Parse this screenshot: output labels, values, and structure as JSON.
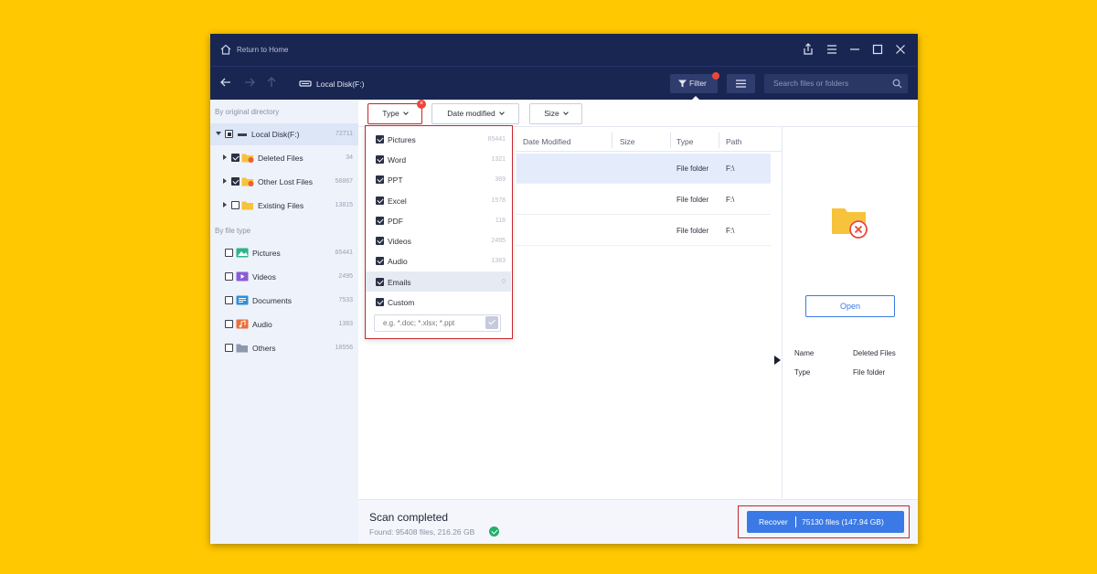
{
  "titlebar": {
    "home_label": "Return to Home"
  },
  "navbar": {
    "disk_label": "Local Disk(F:)",
    "filter_label": "Filter",
    "search_placeholder": "Search files or folders"
  },
  "sidebar": {
    "by_directory_title": "By original directory",
    "tree": [
      {
        "label": "Local Disk(F:)",
        "count": "72711"
      },
      {
        "label": "Deleted Files",
        "count": "34"
      },
      {
        "label": "Other Lost Files",
        "count": "58867"
      },
      {
        "label": "Existing Files",
        "count": "13815"
      }
    ],
    "by_type_title": "By file type",
    "types": [
      {
        "label": "Pictures",
        "count": "65441"
      },
      {
        "label": "Videos",
        "count": "2495"
      },
      {
        "label": "Documents",
        "count": "7533"
      },
      {
        "label": "Audio",
        "count": "1383"
      },
      {
        "label": "Others",
        "count": "18556"
      }
    ]
  },
  "filters": {
    "type_label": "Type",
    "date_label": "Date modified",
    "size_label": "Size"
  },
  "type_dropdown": {
    "items": [
      {
        "label": "Pictures",
        "count": "65441"
      },
      {
        "label": "Word",
        "count": "1321"
      },
      {
        "label": "PPT",
        "count": "369"
      },
      {
        "label": "Excel",
        "count": "1578"
      },
      {
        "label": "PDF",
        "count": "118"
      },
      {
        "label": "Videos",
        "count": "2495"
      },
      {
        "label": "Audio",
        "count": "1383"
      },
      {
        "label": "Emails",
        "count": "0"
      },
      {
        "label": "Custom",
        "count": ""
      }
    ],
    "custom_placeholder": "e.g. *.doc; *.xlsx; *.ppt"
  },
  "table": {
    "headers": {
      "date": "Date Modified",
      "size": "Size",
      "type": "Type",
      "path": "Path"
    },
    "rows": [
      {
        "type": "File folder",
        "path": "F:\\"
      },
      {
        "type": "File folder",
        "path": "F:\\"
      },
      {
        "type": "File folder",
        "path": "F:\\"
      }
    ]
  },
  "detail": {
    "open_label": "Open",
    "name_key": "Name",
    "name_value": "Deleted Files",
    "type_key": "Type",
    "type_value": "File folder"
  },
  "bottom": {
    "status_title": "Scan completed",
    "status_sub": "Found: 95408 files, 216.26 GB",
    "recover_label": "Recover",
    "recover_info": "75130 files (147.94 GB)"
  },
  "colors": {
    "accent": "#3b7ae6",
    "titlebar": "#1a2652",
    "highlight": "#c8262c",
    "background": "#ffc800"
  }
}
